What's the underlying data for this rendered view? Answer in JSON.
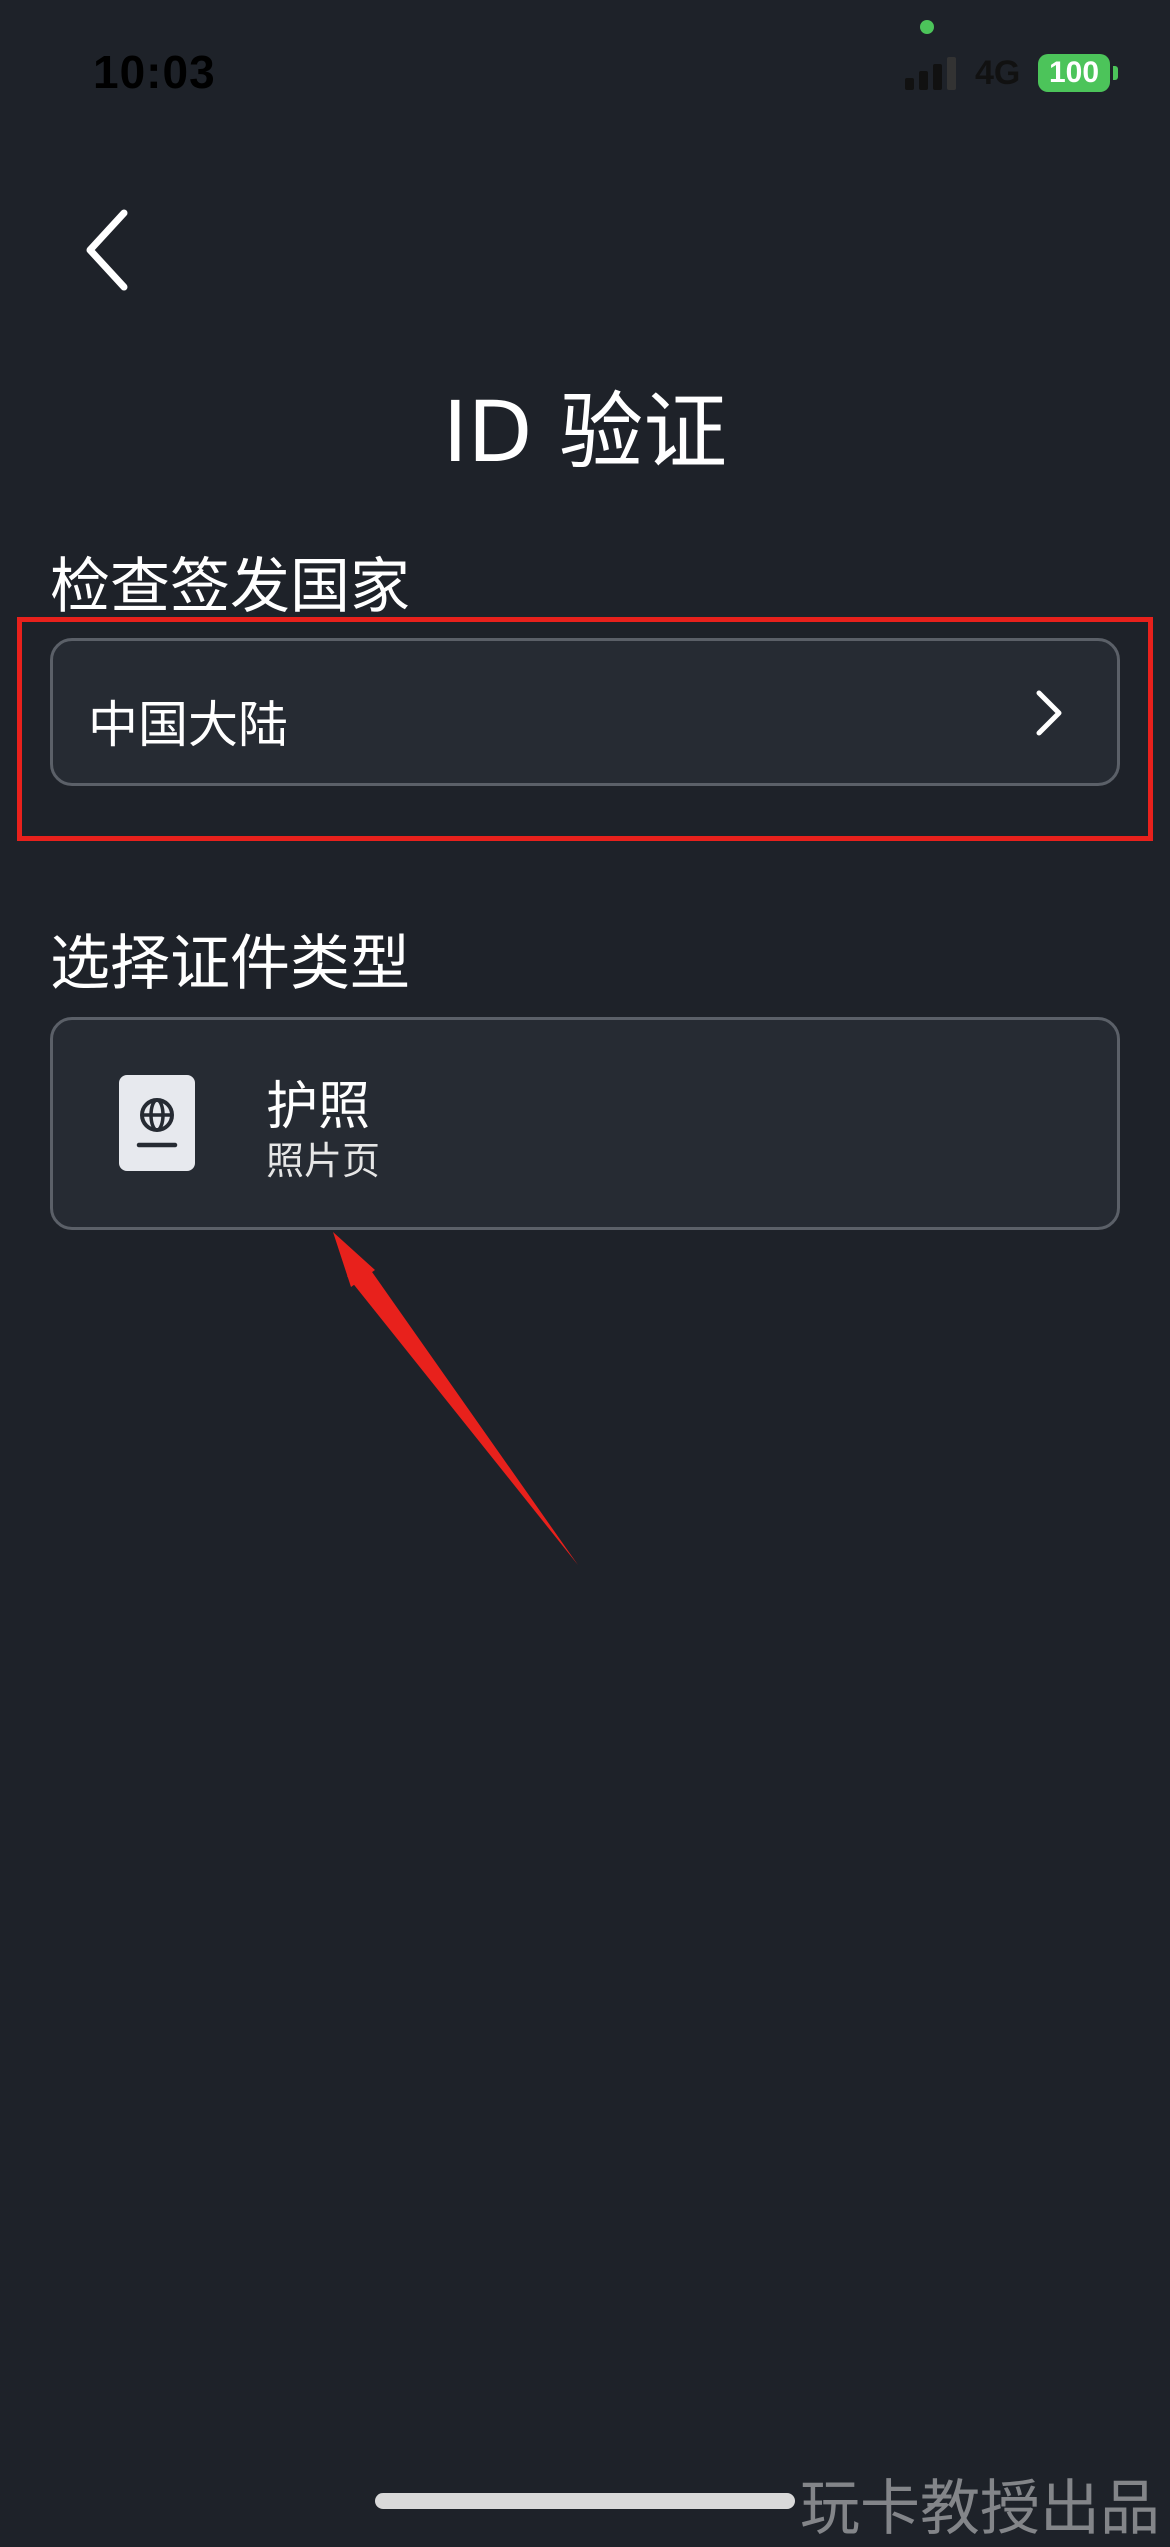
{
  "status_bar": {
    "time": "10:03",
    "network": "4G",
    "battery": "100"
  },
  "header": {
    "back_icon": "chevron-left-icon",
    "title": "ID 验证"
  },
  "issuing_country": {
    "label": "检查签发国家",
    "value": "中国大陆",
    "chevron_icon": "chevron-right-icon"
  },
  "document_type": {
    "label": "选择证件类型",
    "options": [
      {
        "icon": "passport-icon",
        "title": "护照",
        "subtitle": "照片页"
      }
    ]
  },
  "watermark": "玩卡教授出品",
  "colors": {
    "background": "#1e2229",
    "card": "#262b33",
    "card_border": "#5b6068",
    "annotation": "#e8211c",
    "battery": "#4cc45a"
  }
}
